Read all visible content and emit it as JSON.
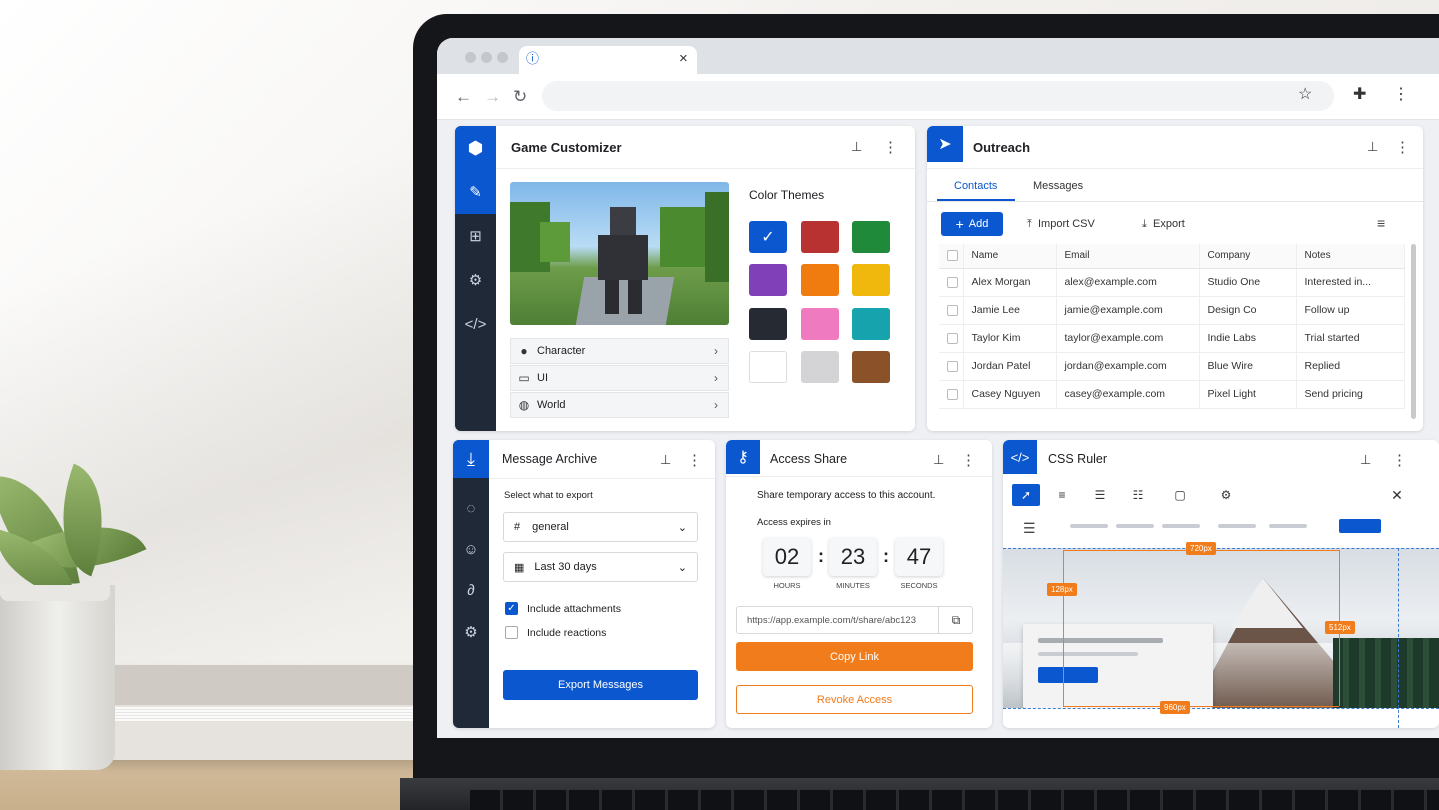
{
  "browser": {
    "tab_icon": "info-icon",
    "tab_close": "×"
  },
  "game": {
    "title": "Game Customizer",
    "color_themes_label": "Color Themes",
    "list": [
      {
        "label": "Character",
        "icon": "person-icon"
      },
      {
        "label": "UI",
        "icon": "monitor-icon"
      },
      {
        "label": "World",
        "icon": "globe-icon"
      }
    ],
    "swatches": [
      "#0b57d0",
      "#b83232",
      "#1e8a3a",
      "#7f40b8",
      "#f07c10",
      "#f0b80c",
      "#262a33",
      "#f07ac0",
      "#16a3ad",
      "#ffffff",
      "#d4d4d6",
      "#8b5128"
    ],
    "selected_swatch": 0
  },
  "outreach": {
    "title": "Outreach",
    "tabs": [
      "Contacts",
      "Messages"
    ],
    "active_tab": 0,
    "add_label": "Add",
    "import_label": "Import CSV",
    "export_label": "Export",
    "columns": [
      "Name",
      "Email",
      "Company",
      "Notes"
    ],
    "rows": [
      [
        "Alex Morgan",
        "alex@example.com",
        "Studio One",
        "Interested in..."
      ],
      [
        "Jamie Lee",
        "jamie@example.com",
        "Design Co",
        "Follow up"
      ],
      [
        "Taylor Kim",
        "taylor@example.com",
        "Indie Labs",
        "Trial started"
      ],
      [
        "Jordan Patel",
        "jordan@example.com",
        "Blue Wire",
        "Replied"
      ],
      [
        "Casey Nguyen",
        "casey@example.com",
        "Pixel Light",
        "Send pricing"
      ]
    ]
  },
  "archive": {
    "title": "Message Archive",
    "select_label": "Select what to export",
    "channel": "general",
    "range": "Last 30 days",
    "include_attachments": "Include attachments",
    "include_reactions": "Include reactions",
    "attachments_checked": true,
    "reactions_checked": false,
    "export_button": "Export Messages"
  },
  "access": {
    "title": "Access Share",
    "description": "Share temporary access to this account.",
    "expires_label": "Access expires in",
    "hours": "02",
    "minutes": "23",
    "seconds": "47",
    "hours_label": "HOURS",
    "minutes_label": "MINUTES",
    "seconds_label": "SECONDS",
    "link": "https://app.example.com/t/share/abc123",
    "copy_button": "Copy Link",
    "revoke_button": "Revoke Access"
  },
  "ruler": {
    "title": "CSS Ruler",
    "width_label": "720px",
    "top_label": "128px",
    "height_label": "512px",
    "bottom_label": "960px"
  }
}
